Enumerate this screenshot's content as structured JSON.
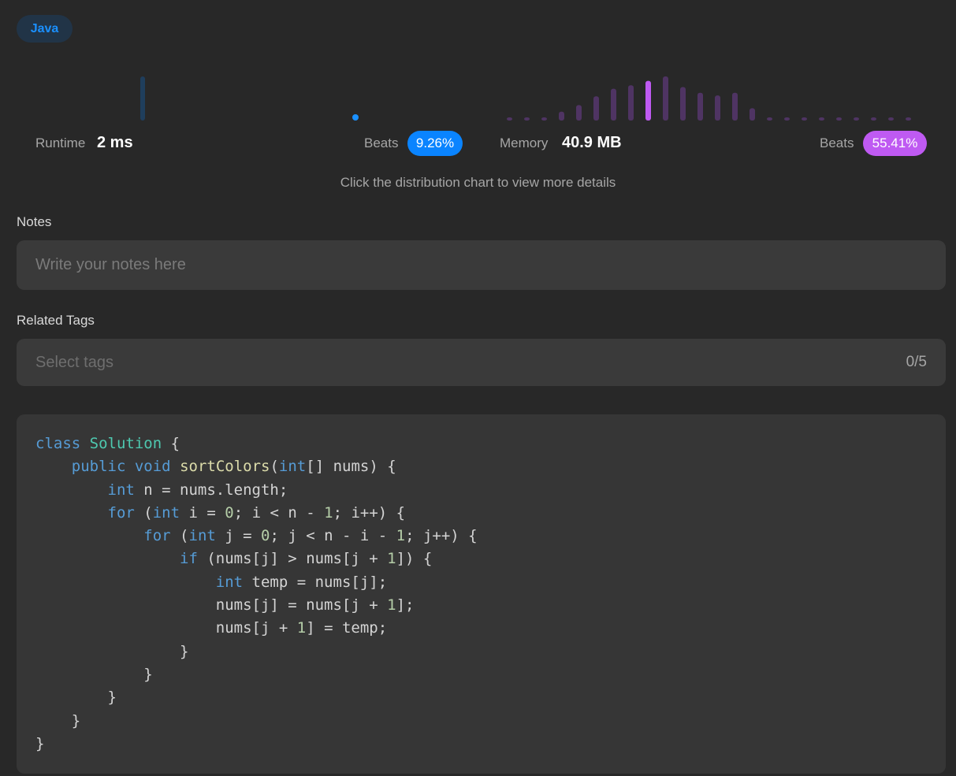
{
  "language": "Java",
  "runtime": {
    "label": "Runtime",
    "value": "2 ms",
    "beats_label": "Beats",
    "beats_value": "9.26%",
    "accent": "#1a90ff",
    "distribution_heights": [
      1.0
    ]
  },
  "memory": {
    "label": "Memory",
    "value": "40.9 MB",
    "beats_label": "Beats",
    "beats_value": "55.41%",
    "accent": "#bf5af2",
    "distribution_heights": [
      0.04,
      0.04,
      0.04,
      0.2,
      0.35,
      0.55,
      0.72,
      0.8,
      0.9,
      1.0,
      0.76,
      0.63,
      0.57,
      0.63,
      0.28,
      0.04,
      0.04,
      0.04,
      0.04,
      0.04,
      0.04,
      0.04,
      0.04,
      0.04
    ],
    "highlight_index": 8
  },
  "hint_text": "Click the distribution chart to view more details",
  "notes": {
    "label": "Notes",
    "placeholder": "Write your notes here"
  },
  "related_tags": {
    "label": "Related Tags",
    "placeholder": "Select tags",
    "count": "0/5"
  },
  "code": [
    [
      [
        "kw",
        "class"
      ],
      [
        "txt",
        " "
      ],
      [
        "cls",
        "Solution"
      ],
      [
        "txt",
        " {"
      ]
    ],
    [
      [
        "txt",
        "    "
      ],
      [
        "kw",
        "public"
      ],
      [
        "txt",
        " "
      ],
      [
        "kw",
        "void"
      ],
      [
        "txt",
        " "
      ],
      [
        "fn",
        "sortColors"
      ],
      [
        "txt",
        "("
      ],
      [
        "kw",
        "int"
      ],
      [
        "txt",
        "[] nums) {"
      ]
    ],
    [
      [
        "txt",
        "        "
      ],
      [
        "kw",
        "int"
      ],
      [
        "txt",
        " n = nums.length;"
      ]
    ],
    [
      [
        "txt",
        "        "
      ],
      [
        "kw",
        "for"
      ],
      [
        "txt",
        " ("
      ],
      [
        "kw",
        "int"
      ],
      [
        "txt",
        " i = "
      ],
      [
        "num",
        "0"
      ],
      [
        "txt",
        "; i < n - "
      ],
      [
        "num",
        "1"
      ],
      [
        "txt",
        "; i++) {"
      ]
    ],
    [
      [
        "txt",
        "            "
      ],
      [
        "kw",
        "for"
      ],
      [
        "txt",
        " ("
      ],
      [
        "kw",
        "int"
      ],
      [
        "txt",
        " j = "
      ],
      [
        "num",
        "0"
      ],
      [
        "txt",
        "; j < n - i - "
      ],
      [
        "num",
        "1"
      ],
      [
        "txt",
        "; j++) {"
      ]
    ],
    [
      [
        "txt",
        "                "
      ],
      [
        "kw",
        "if"
      ],
      [
        "txt",
        " (nums[j] > nums[j + "
      ],
      [
        "num",
        "1"
      ],
      [
        "txt",
        "]) {"
      ]
    ],
    [
      [
        "txt",
        "                    "
      ],
      [
        "kw",
        "int"
      ],
      [
        "txt",
        " temp = nums[j];"
      ]
    ],
    [
      [
        "txt",
        "                    nums[j] = nums[j + "
      ],
      [
        "num",
        "1"
      ],
      [
        "txt",
        "];"
      ]
    ],
    [
      [
        "txt",
        "                    nums[j + "
      ],
      [
        "num",
        "1"
      ],
      [
        "txt",
        "] = temp;"
      ]
    ],
    [
      [
        "txt",
        "                }"
      ]
    ],
    [
      [
        "txt",
        "            }"
      ]
    ],
    [
      [
        "txt",
        "        }"
      ]
    ],
    [
      [
        "txt",
        "    }"
      ]
    ],
    [
      [
        "txt",
        "}"
      ]
    ]
  ]
}
